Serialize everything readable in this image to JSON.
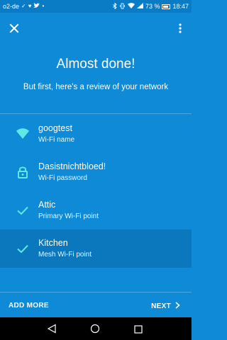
{
  "status_bar": {
    "carrier": "o2-de",
    "battery_percent": "73 %",
    "time": "18:47",
    "icons": [
      "signal-check-icon",
      "heart-icon",
      "twitter-icon",
      "notification-icon",
      "bluetooth-icon",
      "vibrate-icon",
      "wifi-icon",
      "cell-signal-icon",
      "battery-icon"
    ]
  },
  "toolbar": {
    "close_icon": "close-icon",
    "more_icon": "more-vert-icon"
  },
  "header": {
    "title": "Almost done!",
    "subtitle": "But first, here's a review of your network"
  },
  "review": {
    "items": [
      {
        "icon": "wifi-icon",
        "primary": "googtest",
        "secondary": "Wi-Fi name"
      },
      {
        "icon": "lock-icon",
        "primary": "Dasistnichtbloed!",
        "secondary": "Wi-Fi password"
      },
      {
        "icon": "check-icon",
        "primary": "Attic",
        "secondary": "Primary Wi-Fi point"
      },
      {
        "icon": "check-icon",
        "primary": "Kitchen",
        "secondary": "Mesh Wi-Fi point"
      }
    ]
  },
  "actions": {
    "add_more": "ADD MORE",
    "next": "NEXT"
  },
  "colors": {
    "background": "#0e8ad7",
    "highlight_row": "#0b78bd",
    "icon_accent": "#5ee8e6"
  }
}
